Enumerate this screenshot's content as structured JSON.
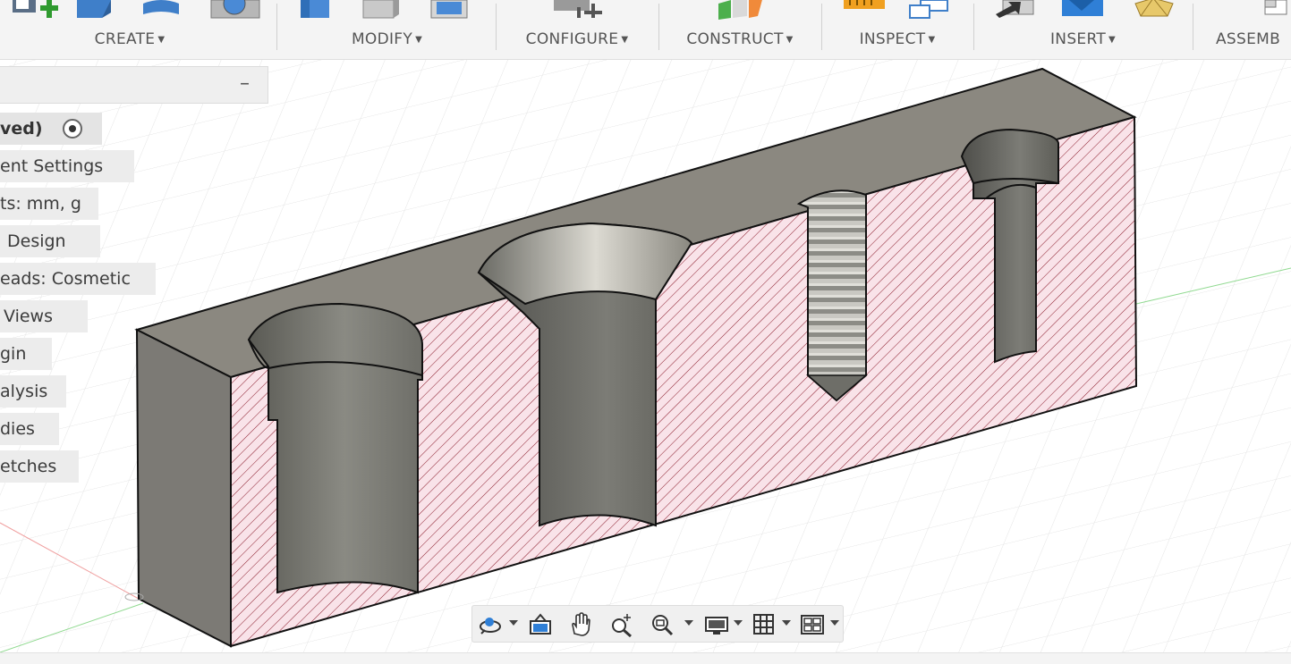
{
  "toolbar": {
    "groups": [
      {
        "label": "CREATE"
      },
      {
        "label": "MODIFY"
      },
      {
        "label": "CONFIGURE"
      },
      {
        "label": "CONSTRUCT"
      },
      {
        "label": "INSPECT"
      },
      {
        "label": "INSERT"
      },
      {
        "label": "ASSEMB"
      }
    ]
  },
  "browser": {
    "items": [
      {
        "label": "ved)"
      },
      {
        "label": "ent Settings"
      },
      {
        "label": "ts: mm, g"
      },
      {
        "label": "Design"
      },
      {
        "label": "eads: Cosmetic"
      },
      {
        "label": "Views"
      },
      {
        "label": "gin"
      },
      {
        "label": "alysis"
      },
      {
        "label": "dies"
      },
      {
        "label": "etches"
      }
    ],
    "collapse_symbol": "–"
  },
  "navbar": {
    "icons": [
      "orbit-icon",
      "look-at-icon",
      "pan-hand-icon",
      "zoom-icon",
      "fit-zoom-icon",
      "display-settings-icon",
      "grid-settings-icon",
      "viewports-icon"
    ]
  },
  "colors": {
    "section_fill": "#f9e3e9",
    "hatch": "#8a1a2a",
    "body_face": "#7e7c76",
    "top_face": "#8b8880",
    "grid": "#e3e3e3"
  }
}
